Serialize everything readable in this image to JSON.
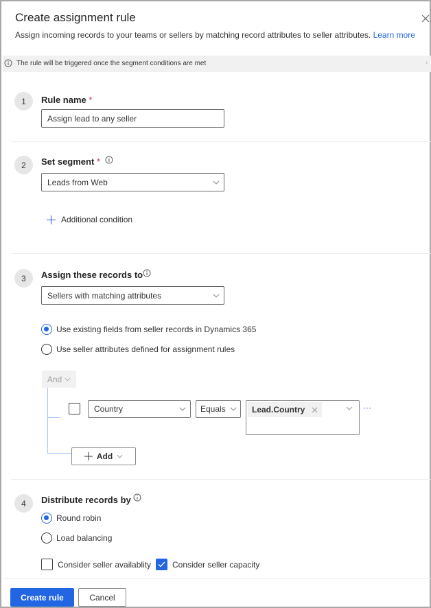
{
  "header": {
    "title": "Create assignment rule",
    "subtitle": "Assign incoming records to your teams or sellers by matching record attributes to seller attributes.",
    "learn_more": "Learn more",
    "close_icon": "close-icon"
  },
  "banner": {
    "text": "The rule will be triggered once the segment conditions are met",
    "icon": "info-icon"
  },
  "steps": {
    "rule_name": {
      "number": "1",
      "label": "Rule name",
      "required_mark": "*",
      "value": "Assign lead to any seller"
    },
    "segment": {
      "number": "2",
      "label": "Set segment",
      "required_mark": "*",
      "selected": "Leads from Web",
      "additional_condition": "Additional condition"
    },
    "assign_to": {
      "number": "3",
      "label": "Assign these records to",
      "selected": "Sellers with matching attributes",
      "options": [
        {
          "label": "Use existing fields from seller records in Dynamics 365",
          "selected": true
        },
        {
          "label": "Use seller attributes defined for assignment rules",
          "selected": false
        }
      ],
      "condition_group": {
        "operator": "And",
        "row": {
          "checked": false,
          "field": "Country",
          "comparator": "Equals",
          "value_chip": "Lead.Country",
          "more": "···"
        },
        "add_label": "Add"
      }
    },
    "distribute": {
      "number": "4",
      "label": "Distribute records by",
      "options": [
        {
          "label": "Round robin",
          "selected": true
        },
        {
          "label": "Load balancing",
          "selected": false
        }
      ],
      "checkboxes": [
        {
          "label": "Consider seller availablity",
          "checked": false
        },
        {
          "label": "Consider seller capacity",
          "checked": true
        }
      ]
    }
  },
  "footer": {
    "create": "Create rule",
    "cancel": "Cancel"
  },
  "colors": {
    "accent": "#2266e3",
    "required": "#c4314b",
    "banner_bg": "#f1f1f1"
  }
}
